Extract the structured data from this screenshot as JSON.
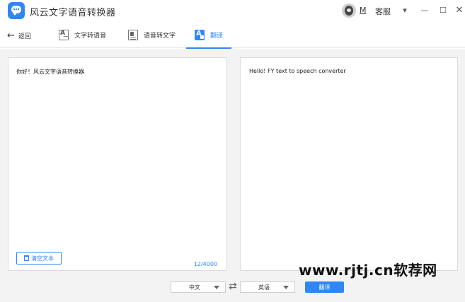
{
  "app": {
    "title": "风云文字语音转换器"
  },
  "user": {
    "name": "M",
    "service_label": "客服"
  },
  "window_controls": {
    "menu": "▾",
    "minimize": "—",
    "maximize": "☐",
    "close": "✕"
  },
  "nav": {
    "back_label": "返回",
    "tabs": [
      {
        "label": "文字转语音",
        "icon": "text-doc-icon",
        "active": false
      },
      {
        "label": "语音转文字",
        "icon": "speech-doc-icon",
        "active": false
      },
      {
        "label": "翻译",
        "icon": "translate-icon",
        "active": true
      }
    ]
  },
  "source": {
    "text": "你好！风云文字语音转换器",
    "clear_label": "清空文本",
    "char_count": "12/4000"
  },
  "result": {
    "text": "Hello! FY text to speech converter"
  },
  "controls": {
    "source_lang": "中文",
    "target_lang": "英语",
    "swap_glyph": "⇄",
    "translate_label": "翻译"
  },
  "watermark": {
    "text": "www.rjtj.cn软荐网"
  },
  "colors": {
    "accent": "#2f86f6",
    "background": "#f3f3f3"
  }
}
